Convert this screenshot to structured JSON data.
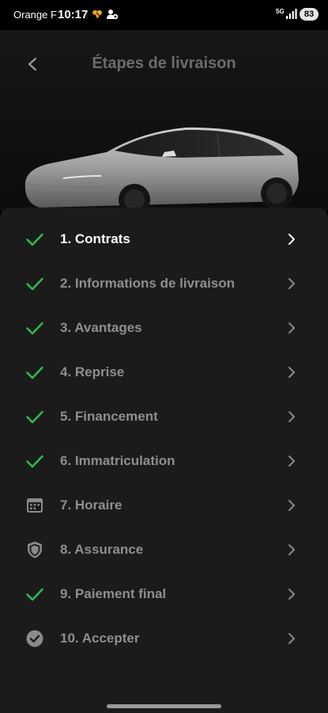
{
  "status_bar": {
    "carrier": "Orange F",
    "time": "10:17",
    "network": "5G",
    "battery": "83"
  },
  "header": {
    "title": "Étapes de livraison"
  },
  "steps": [
    {
      "label": "1. Contrats",
      "status": "done",
      "icon": "check-icon"
    },
    {
      "label": "2. Informations de livraison",
      "status": "done",
      "icon": "check-icon"
    },
    {
      "label": "3. Avantages",
      "status": "done",
      "icon": "check-icon"
    },
    {
      "label": "4. Reprise",
      "status": "done",
      "icon": "check-icon"
    },
    {
      "label": "5. Financement",
      "status": "done",
      "icon": "check-icon"
    },
    {
      "label": "6. Immatriculation",
      "status": "done",
      "icon": "check-icon"
    },
    {
      "label": "7. Horaire",
      "status": "pending",
      "icon": "calendar-icon"
    },
    {
      "label": "8. Assurance",
      "status": "pending",
      "icon": "shield-icon"
    },
    {
      "label": "9. Paiement final",
      "status": "done",
      "icon": "check-icon"
    },
    {
      "label": "10. Accepter",
      "status": "pending",
      "icon": "check-circle-icon"
    }
  ],
  "colors": {
    "check_green": "#2fb84e",
    "pending_icon": "#8a8a8a",
    "sheet_background": "#1b1b1b",
    "inactive_text": "#8e8e8e",
    "active_text": "#ffffff"
  }
}
